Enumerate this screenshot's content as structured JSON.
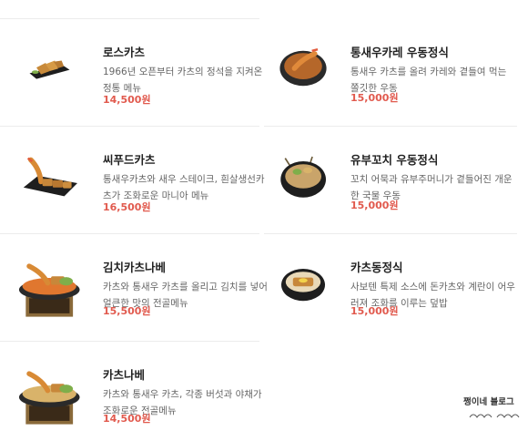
{
  "menu": {
    "left": [
      {
        "name": "로스카츠",
        "desc": "1966년 오픈부터 카츠의 정석을 지켜온 정통 메뉴",
        "price": "14,500원",
        "icon": "pork-cutlet-plate-icon"
      },
      {
        "name": "씨푸드카츠",
        "desc": "통새우카츠와 새우 스테이크, 흰살생선카츠가 조화로운 마니아 메뉴",
        "price": "16,500원",
        "icon": "seafood-cutlet-plate-icon"
      },
      {
        "name": "김치카츠나베",
        "desc": "카츠와 통새우 카츠를 올리고 김치를 넣어 얼큰한 맛의 전골메뉴",
        "price": "15,500원",
        "icon": "hotpot-icon"
      },
      {
        "name": "카츠나베",
        "desc": "카츠와 통새우 카츠, 각종 버섯과 야채가 조화로운 전골메뉴",
        "price": "14,500원",
        "icon": "hotpot-icon"
      }
    ],
    "right": [
      {
        "name": "통새우카레 우동정식",
        "desc": "통새우 카츠를 올려 카레와 곁들여 먹는 쫄깃한 우동",
        "price": "15,000원",
        "icon": "curry-udon-bowl-icon"
      },
      {
        "name": "유부꼬치 우동정식",
        "desc": "꼬치 어묵과 유부주머니가 곁들어진 개운한 국물 우동",
        "price": "15,000원",
        "icon": "udon-bowl-icon"
      },
      {
        "name": "카츠동정식",
        "desc": "사보텐 특제 소스에 돈카츠와 계란이 어우러져 조화를 이루는 덮밥",
        "price": "15,000원",
        "icon": "katsudon-bowl-icon"
      }
    ]
  },
  "watermark": {
    "text": "쩡이네 블로그"
  },
  "colors": {
    "price": "#e15a4e",
    "divider": "#ececec"
  }
}
